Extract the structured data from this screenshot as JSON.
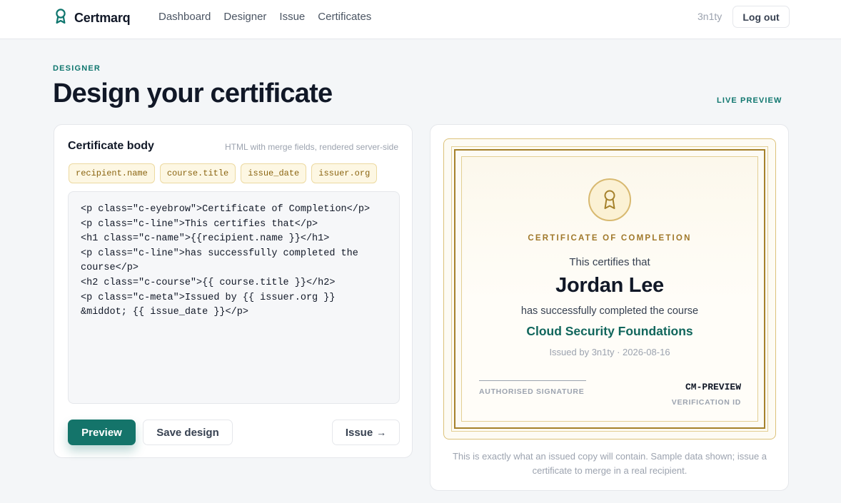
{
  "app": {
    "brand": "Certmarq"
  },
  "nav": {
    "items": [
      "Dashboard",
      "Designer",
      "Issue",
      "Certificates"
    ]
  },
  "user": {
    "name": "3n1ty",
    "logout_label": "Log out"
  },
  "header": {
    "eyebrow": "DESIGNER",
    "title": "Design your certificate",
    "live_preview": "LIVE PREVIEW"
  },
  "editor": {
    "title": "Certificate body",
    "hint": "HTML with merge fields, rendered server-side",
    "merge_fields": [
      "recipient.name",
      "course.title",
      "issue_date",
      "issuer.org"
    ],
    "code": "<p class=\"c-eyebrow\">Certificate of Completion</p>\n<p class=\"c-line\">This certifies that</p>\n<h1 class=\"c-name\">{{recipient.name }}</h1>\n<p class=\"c-line\">has successfully completed the course</p>\n<h2 class=\"c-course\">{{ course.title }}</h2>\n<p class=\"c-meta\">Issued by {{ issuer.org }} &middot; {{ issue_date }}</p>",
    "preview_label": "Preview",
    "save_label": "Save design",
    "issue_label": "Issue",
    "issue_arrow": "→"
  },
  "certificate": {
    "eyebrow": "CERTIFICATE OF COMPLETION",
    "line1": "This certifies that",
    "recipient": "Jordan Lee",
    "line2": "has successfully completed the course",
    "course": "Cloud Security Foundations",
    "meta": "Issued by 3n1ty · 2026-08-16",
    "signature_label": "AUTHORISED SIGNATURE",
    "verification_id": "CM-PREVIEW",
    "verification_label": "VERIFICATION ID",
    "seal_icon": "ribbon-award-icon"
  },
  "preview_note": "This is exactly what an issued copy will contain. Sample data shown; issue a certificate to merge in a real recipient.",
  "colors": {
    "accent": "#14746a",
    "gold": "#a5812b",
    "chip_bg": "#fdf7e3",
    "chip_text": "#8a6410"
  }
}
